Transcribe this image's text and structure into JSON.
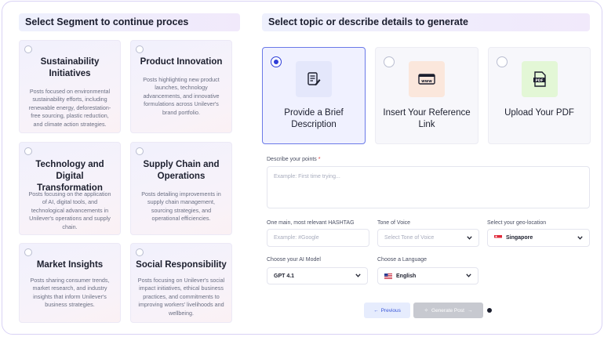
{
  "left_panel": {
    "title": "Select Segment to continue proces",
    "segments": [
      {
        "title": "Sustainability Initiatives",
        "desc": "Posts focused on environmental sustainability efforts, including renewable energy, deforestation-free sourcing, plastic reduction, and climate action strategies."
      },
      {
        "title": "Product Innovation",
        "desc": "Posts highlighting new product launches, technology advancements, and innovative formulations across Unilever's brand portfolio."
      },
      {
        "title": "Technology and Digital Transformation",
        "desc": "Posts focusing on the application of AI, digital tools, and technological advancements in Unilever's operations and supply chain."
      },
      {
        "title": "Supply Chain and Operations",
        "desc": "Posts detailing improvements in supply chain management, sourcing strategies, and operational efficiencies."
      },
      {
        "title": "Market Insights",
        "desc": "Posts sharing consumer trends, market research, and industry insights that inform Unilever's business strategies."
      },
      {
        "title": "Social Responsibility",
        "desc": "Posts focusing on Unilever's social impact initiatives, ethical business practices, and commitments to improving workers' livelihoods and wellbeing."
      }
    ]
  },
  "right_panel": {
    "title": "Select topic or describe details to generate",
    "options": [
      {
        "label": "Provide a Brief Description",
        "icon": "document-edit-icon",
        "selected": true
      },
      {
        "label": "Insert Your Reference Link",
        "icon": "www-link-icon",
        "selected": false
      },
      {
        "label": "Upload Your PDF",
        "icon": "pdf-file-icon",
        "selected": false
      }
    ],
    "describe": {
      "label": "Describe your points",
      "required_mark": "*",
      "placeholder": "Example: First time trying..."
    },
    "hashtag": {
      "label": "One main, most relevant HASHTAG",
      "placeholder": "Example: #Google"
    },
    "tone": {
      "label": "Tone of Voice",
      "placeholder": "Select Tone of Voice"
    },
    "geo": {
      "label": "Select your geo-location",
      "value": "Singapore"
    },
    "model": {
      "label": "Choose your AI Model",
      "value": "GPT 4.1"
    },
    "language": {
      "label": "Choose a Language",
      "value": "English"
    },
    "buttons": {
      "previous": "Previous",
      "generate": "Generate Post"
    }
  },
  "colors": {
    "accent": "#2f3ed8",
    "disabled": "#c7c9d0",
    "title_gradient_start": "#eef0fd",
    "title_gradient_end": "#f1e9fb"
  }
}
